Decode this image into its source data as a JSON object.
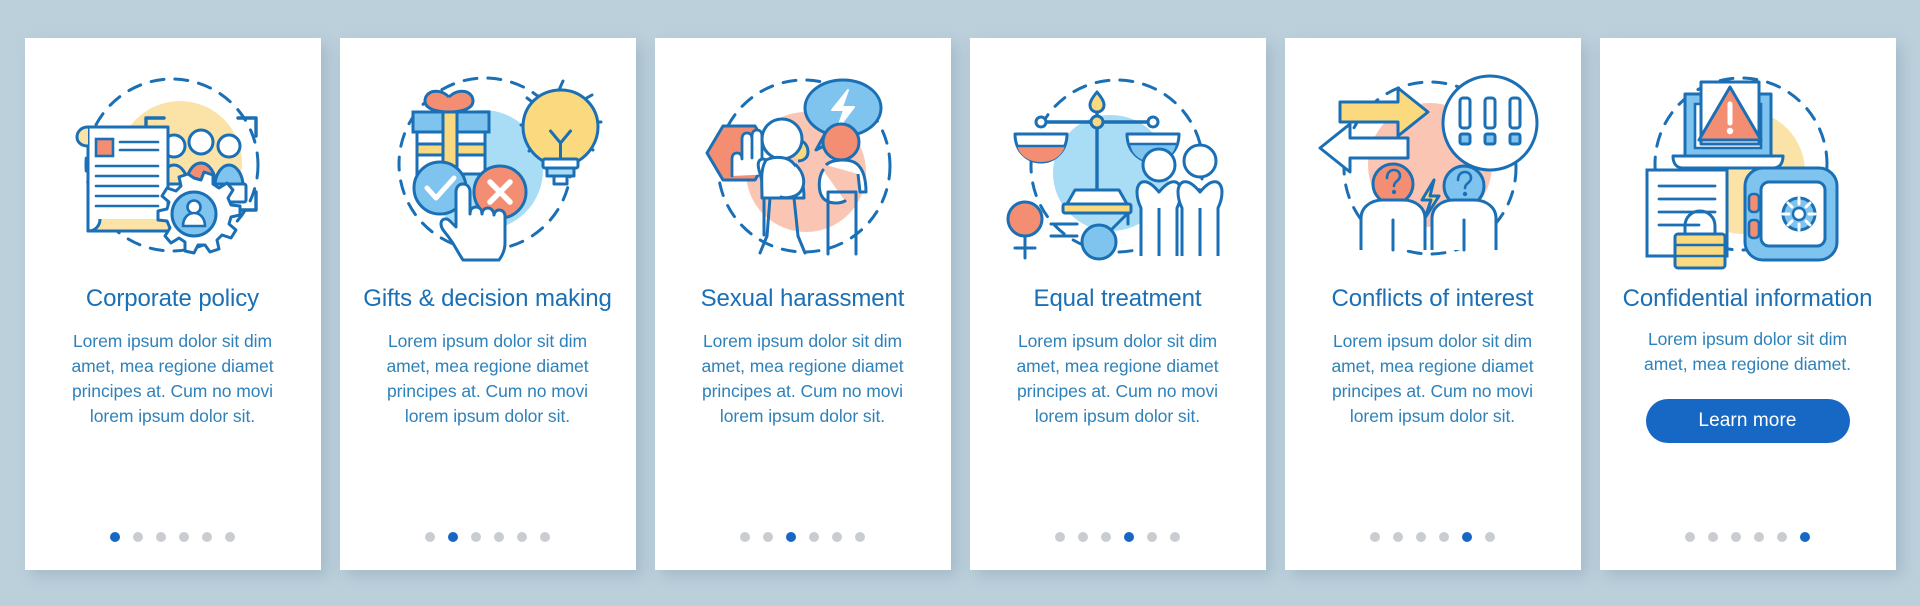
{
  "page": {
    "background_color": "#bcd0dc",
    "card_background": "#ffffff",
    "title_color": "#1a6fb5",
    "body_color": "#2e81b9",
    "accent_color": "#1668c4",
    "dot_inactive_color": "#c9cdd1"
  },
  "cards": [
    {
      "icon_name": "corporate-policy-icon",
      "title": "Corporate policy",
      "body": "Lorem ipsum dolor sit dim amet, mea regione diamet principes at. Cum no movi lorem ipsum dolor sit.",
      "dots": {
        "count": 6,
        "active": 1
      }
    },
    {
      "icon_name": "gifts-decision-making-icon",
      "title": "Gifts & decision making",
      "body": "Lorem ipsum dolor sit dim amet, mea regione diamet principes at. Cum no movi lorem ipsum dolor sit.",
      "dots": {
        "count": 6,
        "active": 2
      }
    },
    {
      "icon_name": "sexual-harassment-icon",
      "title": "Sexual harassment",
      "body": "Lorem ipsum dolor sit dim amet, mea regione diamet principes at. Cum no movi lorem ipsum dolor sit.",
      "dots": {
        "count": 6,
        "active": 3
      }
    },
    {
      "icon_name": "equal-treatment-icon",
      "title": "Equal treatment",
      "body": "Lorem ipsum dolor sit dim amet, mea regione diamet principes at. Cum no movi lorem ipsum dolor sit.",
      "dots": {
        "count": 6,
        "active": 4
      }
    },
    {
      "icon_name": "conflicts-of-interest-icon",
      "title": "Conflicts of interest",
      "body": "Lorem ipsum dolor sit dim amet, mea regione diamet principes at. Cum no movi lorem ipsum dolor sit.",
      "dots": {
        "count": 6,
        "active": 5
      }
    },
    {
      "icon_name": "confidential-information-icon",
      "title": "Confidential information",
      "body": "Lorem ipsum dolor sit dim amet, mea regione diamet.",
      "cta_label": "Learn more",
      "dots": {
        "count": 6,
        "active": 6
      }
    }
  ]
}
